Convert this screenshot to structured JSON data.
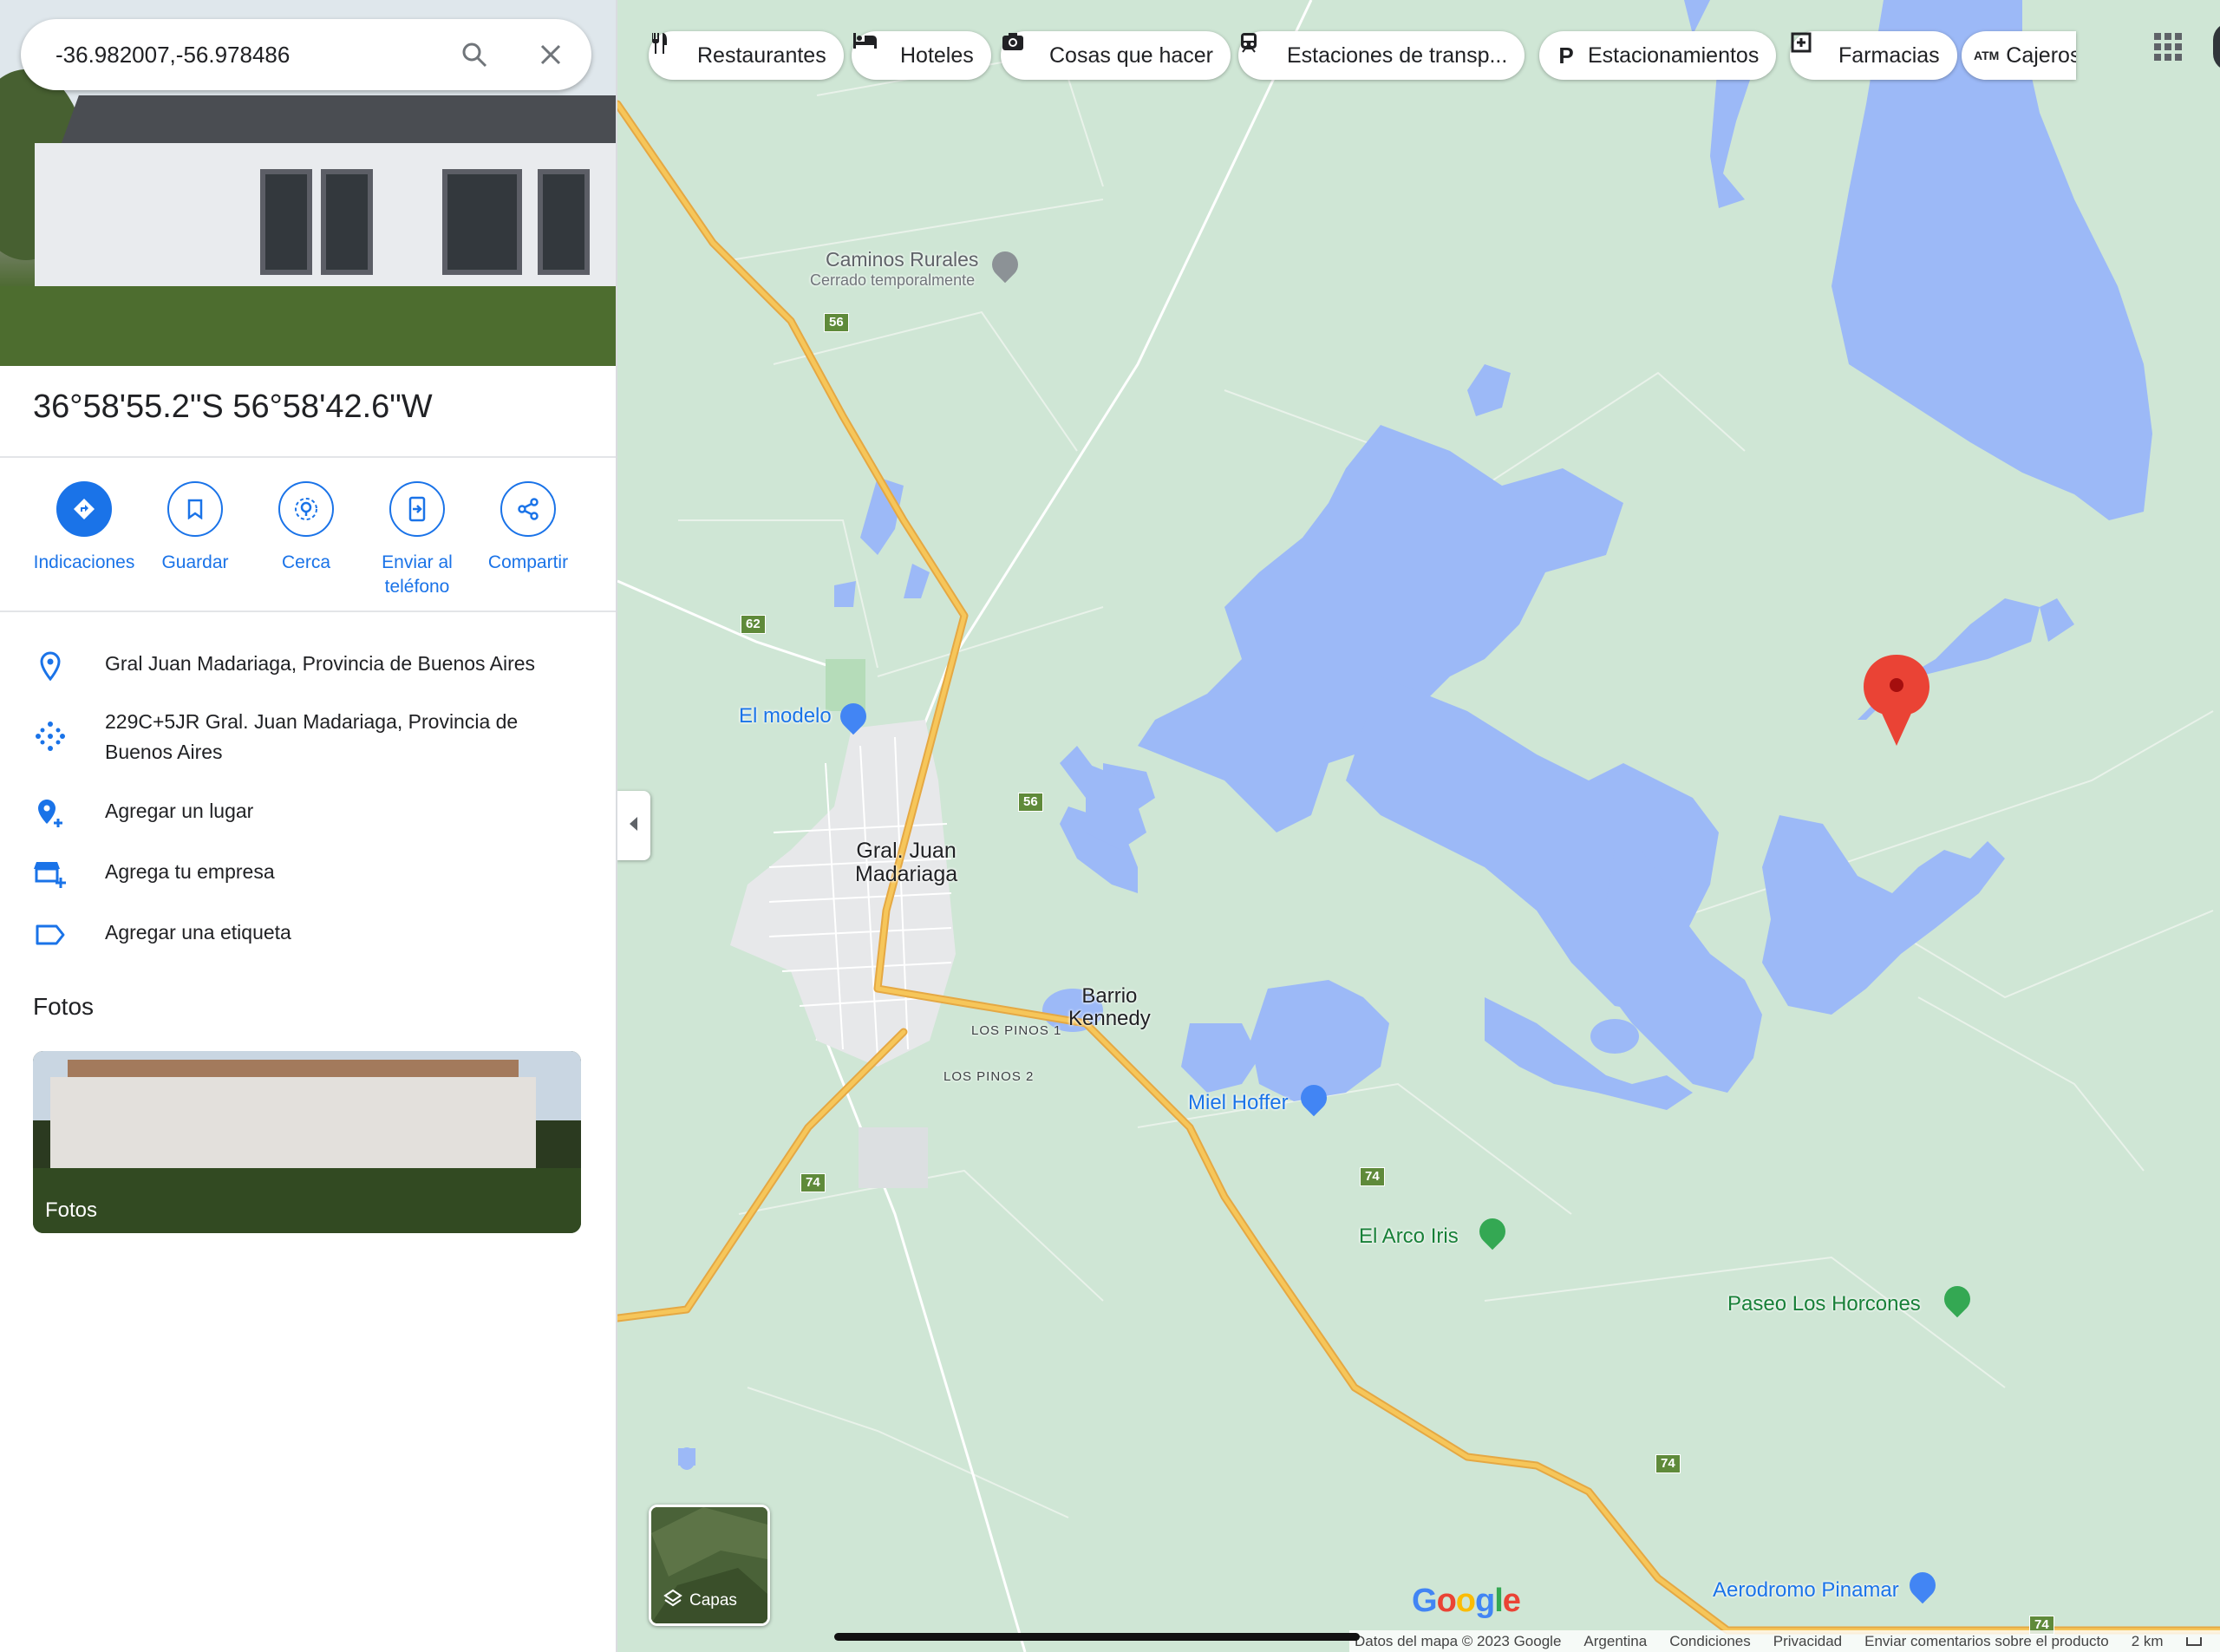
{
  "search": {
    "value": "-36.982007,-56.978486",
    "search_icon": "search-icon",
    "close_icon": "close-icon"
  },
  "place": {
    "title": "36°58'55.2\"S 56°58'42.6\"W",
    "actions": [
      {
        "label": "Indicaciones",
        "icon": "directions-icon"
      },
      {
        "label": "Guardar",
        "icon": "bookmark-icon"
      },
      {
        "label": "Cerca",
        "icon": "nearby-icon"
      },
      {
        "label": "Enviar al teléfono",
        "icon": "send-to-phone-icon"
      },
      {
        "label": "Compartir",
        "icon": "share-icon"
      }
    ],
    "info": [
      {
        "text": "Gral Juan Madariaga, Provincia de Buenos Aires",
        "icon": "location-pin-icon"
      },
      {
        "text": "229C+5JR Gral. Juan Madariaga, Provincia de Buenos Aires",
        "icon": "plus-code-icon"
      },
      {
        "text": "Agregar un lugar",
        "icon": "add-place-icon"
      },
      {
        "text": "Agrega tu empresa",
        "icon": "add-business-icon"
      },
      {
        "text": "Agregar una etiqueta",
        "icon": "label-icon"
      }
    ],
    "photos_heading": "Fotos",
    "photos_caption": "Fotos"
  },
  "categories": [
    {
      "label": "Restaurantes",
      "icon": "restaurant-icon"
    },
    {
      "label": "Hoteles",
      "icon": "hotel-icon"
    },
    {
      "label": "Cosas que hacer",
      "icon": "camera-icon"
    },
    {
      "label": "Estaciones de transp...",
      "icon": "transit-icon"
    },
    {
      "label": "Estacionamientos",
      "icon": "parking-icon"
    },
    {
      "label": "Farmacias",
      "icon": "pharmacy-icon"
    },
    {
      "label": "Cajeros",
      "icon": "atm-icon"
    }
  ],
  "map": {
    "labels": {
      "caminos": "Caminos Rurales",
      "caminos_status": "Cerrado temporalmente",
      "el_modelo": "El modelo",
      "town_line1": "Gral. Juan",
      "town_line2": "Madariaga",
      "barrio_line1": "Barrio",
      "barrio_line2": "Kennedy",
      "los_pinos_1": "LOS PINOS 1",
      "los_pinos_2": "LOS PINOS 2",
      "miel_hoffer": "Miel Hoffer",
      "el_arco_iris": "El Arco Iris",
      "paseo": "Paseo Los Horcones",
      "aerodromo": "Aerodromo Pinamar"
    },
    "route_shields": {
      "r56a": "56",
      "r56b": "56",
      "r62": "62",
      "r74a": "74",
      "r74b": "74",
      "r74c": "74",
      "r74d": "74"
    },
    "layers_label": "Capas",
    "logo": "Google",
    "colors": {
      "land": "#cfe6d5",
      "water": "#9cb9f7",
      "road": "#f6c65a",
      "town": "#e7e8ea",
      "pin": "#ea4335",
      "accent": "#1a73e8"
    }
  },
  "footer": {
    "items": [
      "Datos del mapa © 2023 Google",
      "Argentina",
      "Condiciones",
      "Privacidad",
      "Enviar comentarios sobre el producto"
    ],
    "scale": "2 km"
  }
}
